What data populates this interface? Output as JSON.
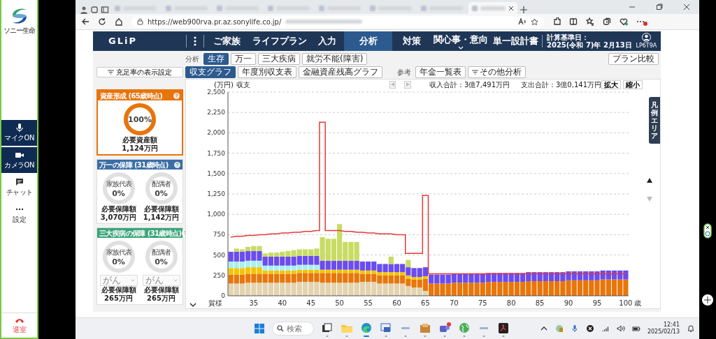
{
  "app_sidebar": {
    "logo_text": "ソニー生命",
    "items": [
      {
        "kind": "mic",
        "label": "マイクON",
        "on": true
      },
      {
        "kind": "camera",
        "label": "カメラON",
        "on": true
      },
      {
        "kind": "chat",
        "label": "チャット",
        "on": false
      },
      {
        "kind": "more",
        "label": "設定",
        "on": false
      }
    ],
    "leave": "退室"
  },
  "browser": {
    "tabs": [
      {
        "selected": false
      },
      {
        "selected": false
      },
      {
        "selected": false
      },
      {
        "selected": false
      },
      {
        "selected": false
      },
      {
        "selected": false
      },
      {
        "selected": false
      },
      {
        "selected": true
      }
    ],
    "url": "https://web900rva.pr.az.sonylife.co.jp/"
  },
  "header": {
    "brand": "GLiP",
    "nav": [
      {
        "label": "ご家族",
        "kind": "link",
        "selected": false
      },
      {
        "label": "ライフプラン",
        "kind": "link",
        "selected": false
      },
      {
        "label": "入力",
        "kind": "link",
        "selected": false
      },
      {
        "label": "分析",
        "kind": "link",
        "selected": true
      },
      {
        "label": "対策",
        "kind": "link",
        "selected": false
      },
      {
        "label": "関心事・意向",
        "kind": "dropdown",
        "selected": false
      },
      {
        "label": "単一設計書",
        "kind": "link",
        "selected": false
      }
    ],
    "date_label": "計算基準日：",
    "date": "2025(令和 7)年 2月13日",
    "user": "LP6T9A"
  },
  "analysis": {
    "label": "分析",
    "tabs": [
      {
        "label": "生存",
        "selected": true
      },
      {
        "label": "万一",
        "selected": false
      },
      {
        "label": "三大疾病",
        "selected": false
      },
      {
        "label": "就労不能(障害)",
        "selected": false
      }
    ],
    "compare_button": "プラン比較"
  },
  "views": {
    "tabs": [
      {
        "label": "収支グラフ",
        "selected": true
      },
      {
        "label": "年度別収支表",
        "selected": false
      },
      {
        "label": "金融資産残高グラフ",
        "selected": false
      }
    ],
    "reference_label": "参考",
    "pension_button": "年金一覧表",
    "other_button": "その他分析"
  },
  "coverage": {
    "settings_button": "充足率の表示設定",
    "cards": [
      {
        "title": "資産形成 (65歳時点)",
        "color": "#e8740c",
        "selected": true,
        "items": [
          {
            "value": "100%",
            "level": 1,
            "caption": "必要資産額",
            "amount": "1,124万円"
          }
        ]
      },
      {
        "title": "万一の保障 (31歳時点)",
        "color": "#3a6ea5",
        "selected": false,
        "items": [
          {
            "label": "家族代表",
            "value": "0%",
            "caption": "必要保障額",
            "amount": "3,070万円"
          },
          {
            "label": "配偶者",
            "value": "0%",
            "caption": "必要保障額",
            "amount": "1,142万円"
          }
        ]
      },
      {
        "title": "三大疾病の保障 (31歳時点)",
        "color": "#3aa57a",
        "selected": false,
        "items": [
          {
            "label": "家族代表",
            "value": "0%",
            "select": {
              "value": "がん",
              "disabled": true
            },
            "caption": "必要保障額",
            "amount": "265万円"
          },
          {
            "label": "配偶者",
            "value": "0%",
            "select": {
              "value": "がん",
              "disabled": true
            },
            "caption": "必要保障額",
            "amount": "265万円"
          }
        ]
      }
    ]
  },
  "chart": {
    "pager": [
      {
        "kind": "prev",
        "disabled": true
      },
      {
        "kind": "next",
        "disabled": true
      }
    ],
    "income_total": "収入合計：3億7,491万円",
    "expense_total": "支出合計：3億0,141万円",
    "zoom_in": "拡大",
    "zoom_out": "縮小",
    "person_label": "賀様",
    "unit_label": "歳",
    "legend_tab": "凡例エリア",
    "scroll": [
      {
        "kind": "up",
        "disabled": false
      },
      {
        "kind": "down",
        "disabled": true
      }
    ],
    "chart_data": {
      "type": "bar",
      "stacked": true,
      "grid": true,
      "title": "収支",
      "ylabel": "(万円)",
      "ylim": [
        0,
        2500
      ],
      "yticks": [
        {
          "value": 0,
          "label": "0"
        },
        {
          "value": 250,
          "label": "250"
        },
        {
          "value": 500,
          "label": "500"
        },
        {
          "value": 750,
          "label": "750"
        },
        {
          "value": 1000,
          "label": "1,000"
        },
        {
          "value": 1250,
          "label": "1,250"
        },
        {
          "value": 1500,
          "label": "1,500"
        },
        {
          "value": 1750,
          "label": "1,750"
        },
        {
          "value": 2000,
          "label": "2,000"
        },
        {
          "value": 2250,
          "label": "2,250"
        },
        {
          "value": 2500,
          "label": "2,500"
        }
      ],
      "xlim": [
        30.5,
        100.5
      ],
      "xticks": [
        35,
        40,
        45,
        50,
        55,
        60,
        65,
        70,
        75,
        80,
        85,
        90,
        95,
        100
      ],
      "x": [
        31,
        32,
        33,
        34,
        35,
        36,
        37,
        38,
        39,
        40,
        41,
        42,
        43,
        44,
        45,
        46,
        47,
        48,
        49,
        50,
        51,
        52,
        53,
        54,
        55,
        56,
        57,
        58,
        59,
        60,
        61,
        62,
        63,
        64,
        65,
        66,
        67,
        68,
        69,
        70,
        71,
        72,
        73,
        74,
        75,
        76,
        77,
        78,
        79,
        80,
        81,
        82,
        83,
        84,
        85,
        86,
        87,
        88,
        89,
        90,
        91,
        92,
        93,
        94,
        95,
        96,
        97,
        98,
        99,
        100
      ],
      "series": [
        {
          "color": "#e3d3b0",
          "values": [
            150,
            150,
            150,
            160,
            160,
            160,
            160,
            160,
            160,
            160,
            160,
            160,
            170,
            170,
            170,
            170,
            160,
            160,
            160,
            160,
            160,
            160,
            160,
            170,
            170,
            170,
            150,
            150,
            150,
            150,
            150,
            120,
            100,
            100,
            60,
            0,
            0,
            0,
            0,
            0,
            0,
            0,
            0,
            0,
            0,
            0,
            0,
            0,
            0,
            0,
            0,
            0,
            0,
            0,
            0,
            0,
            0,
            0,
            0,
            0,
            0,
            0,
            0,
            0,
            0,
            0,
            0,
            0,
            0,
            0
          ]
        },
        {
          "color": "#e8760a",
          "values": [
            110,
            110,
            110,
            110,
            110,
            110,
            110,
            110,
            110,
            110,
            110,
            110,
            110,
            110,
            110,
            110,
            120,
            120,
            120,
            120,
            120,
            120,
            120,
            100,
            100,
            100,
            100,
            100,
            100,
            100,
            100,
            90,
            100,
            100,
            150,
            150,
            150,
            150,
            150,
            160,
            160,
            160,
            160,
            160,
            160,
            170,
            170,
            170,
            170,
            170,
            170,
            170,
            180,
            180,
            180,
            180,
            180,
            180,
            180,
            190,
            190,
            190,
            190,
            190,
            190,
            200,
            200,
            200,
            200,
            200
          ]
        },
        {
          "color": "#f5c400",
          "values": [
            80,
            80,
            80,
            80,
            80,
            80,
            40,
            40,
            40,
            40,
            40,
            40,
            40,
            40,
            40,
            40,
            40,
            40,
            40,
            40,
            40,
            40,
            40,
            40,
            40,
            40,
            40,
            40,
            40,
            40,
            40,
            40,
            30,
            30,
            30,
            0,
            0,
            0,
            0,
            0,
            0,
            0,
            0,
            0,
            0,
            0,
            0,
            0,
            0,
            0,
            0,
            0,
            0,
            0,
            0,
            0,
            0,
            0,
            0,
            0,
            0,
            0,
            0,
            0,
            0,
            0,
            0,
            0,
            0,
            0
          ]
        },
        {
          "color": "#a8f0f0",
          "values": [
            80,
            80,
            80,
            80,
            80,
            80,
            60,
            60,
            60,
            60,
            60,
            60,
            60,
            60,
            60,
            60,
            0,
            0,
            0,
            0,
            0,
            0,
            0,
            0,
            0,
            0,
            0,
            0,
            0,
            0,
            0,
            0,
            0,
            0,
            0,
            0,
            0,
            0,
            0,
            0,
            0,
            0,
            0,
            0,
            0,
            0,
            0,
            0,
            0,
            0,
            0,
            0,
            0,
            0,
            0,
            0,
            0,
            0,
            0,
            0,
            0,
            0,
            0,
            0,
            0,
            0,
            0,
            0,
            0,
            0
          ]
        },
        {
          "color": "#6a4cf0",
          "values": [
            120,
            120,
            120,
            120,
            120,
            120,
            110,
            110,
            110,
            110,
            110,
            110,
            110,
            110,
            110,
            110,
            110,
            110,
            110,
            110,
            110,
            110,
            110,
            110,
            110,
            110,
            100,
            100,
            100,
            100,
            100,
            100,
            110,
            110,
            110,
            110,
            110,
            110,
            110,
            110,
            110,
            110,
            110,
            110,
            110,
            110,
            110,
            110,
            110,
            110,
            110,
            110,
            110,
            110,
            110,
            110,
            110,
            110,
            110,
            110,
            110,
            110,
            110,
            110,
            110,
            110,
            110,
            110,
            110,
            110
          ]
        },
        {
          "color": "#c8dc64",
          "values": [
            0,
            40,
            30,
            50,
            60,
            60,
            40,
            50,
            50,
            60,
            70,
            80,
            80,
            80,
            80,
            90,
            290,
            270,
            270,
            450,
            230,
            230,
            230,
            0,
            0,
            0,
            0,
            0,
            90,
            0,
            0,
            90,
            0,
            0,
            0,
            0,
            0,
            0,
            0,
            0,
            0,
            0,
            0,
            0,
            0,
            0,
            0,
            0,
            0,
            0,
            0,
            0,
            0,
            0,
            0,
            0,
            0,
            0,
            0,
            0,
            0,
            0,
            0,
            0,
            0,
            0,
            0,
            0,
            0,
            0
          ]
        }
      ]
    },
    "expense_line": {
      "chart_data": {
        "type": "line",
        "ylim": [
          0,
          2500
        ],
        "xlim": [
          30.5,
          100.5
        ],
        "x": [
          31,
          32,
          33,
          34,
          35,
          36,
          37,
          38,
          39,
          40,
          41,
          42,
          43,
          44,
          45,
          46,
          46.5,
          46.5,
          47.5,
          47.5,
          48,
          49,
          50,
          51,
          52,
          53,
          54,
          55,
          56,
          57,
          58,
          59,
          60,
          61,
          61.5,
          61.5,
          62,
          63,
          64,
          64.5,
          64.5,
          65.5,
          65.5,
          66,
          67,
          68,
          69,
          70,
          71,
          72,
          73,
          74,
          75,
          76,
          77,
          78,
          79,
          80,
          81,
          82,
          83,
          84,
          85,
          86,
          87,
          88,
          89,
          90,
          91,
          92,
          93,
          94,
          95,
          96,
          97,
          98,
          99,
          100
        ],
        "series": [
          {
            "color": "#e53935",
            "values": [
              720,
              730,
              730,
              740,
              740,
              750,
              750,
              760,
              760,
              770,
              770,
              780,
              780,
              790,
              790,
              800,
              800,
              2130,
              2130,
              800,
              800,
              800,
              800,
              790,
              790,
              780,
              780,
              770,
              770,
              760,
              760,
              760,
              750,
              750,
              750,
              520,
              520,
              520,
              520,
              520,
              1230,
              1230,
              270,
              270,
              270,
              270,
              270,
              270,
              270,
              270,
              270,
              270,
              270,
              270,
              270,
              270,
              270,
              270,
              270,
              270,
              270,
              270,
              270,
              270,
              270,
              270,
              270,
              270,
              270,
              270,
              270,
              270,
              270,
              270,
              270,
              270,
              270,
              270
            ]
          }
        ]
      }
    }
  },
  "taskbar": {
    "search_placeholder": "検索",
    "apps": [
      {
        "kind": "taskview",
        "active": false,
        "notification": false
      },
      {
        "kind": "folder",
        "active": false,
        "notification": false
      },
      {
        "kind": "browser",
        "active": true,
        "notification": false
      },
      {
        "kind": "remote",
        "active": false,
        "notification": false
      },
      {
        "kind": "small",
        "active": false,
        "notification": false
      },
      {
        "kind": "box",
        "active": false,
        "notification": false
      },
      {
        "kind": "chat",
        "active": false,
        "notification": true
      },
      {
        "kind": "globe",
        "active": false,
        "notification": false
      },
      {
        "kind": "small",
        "active": false,
        "notification": false
      },
      {
        "kind": "pdf",
        "active": false,
        "notification": false
      }
    ],
    "time": "12:41",
    "date": "2025/02/13"
  }
}
